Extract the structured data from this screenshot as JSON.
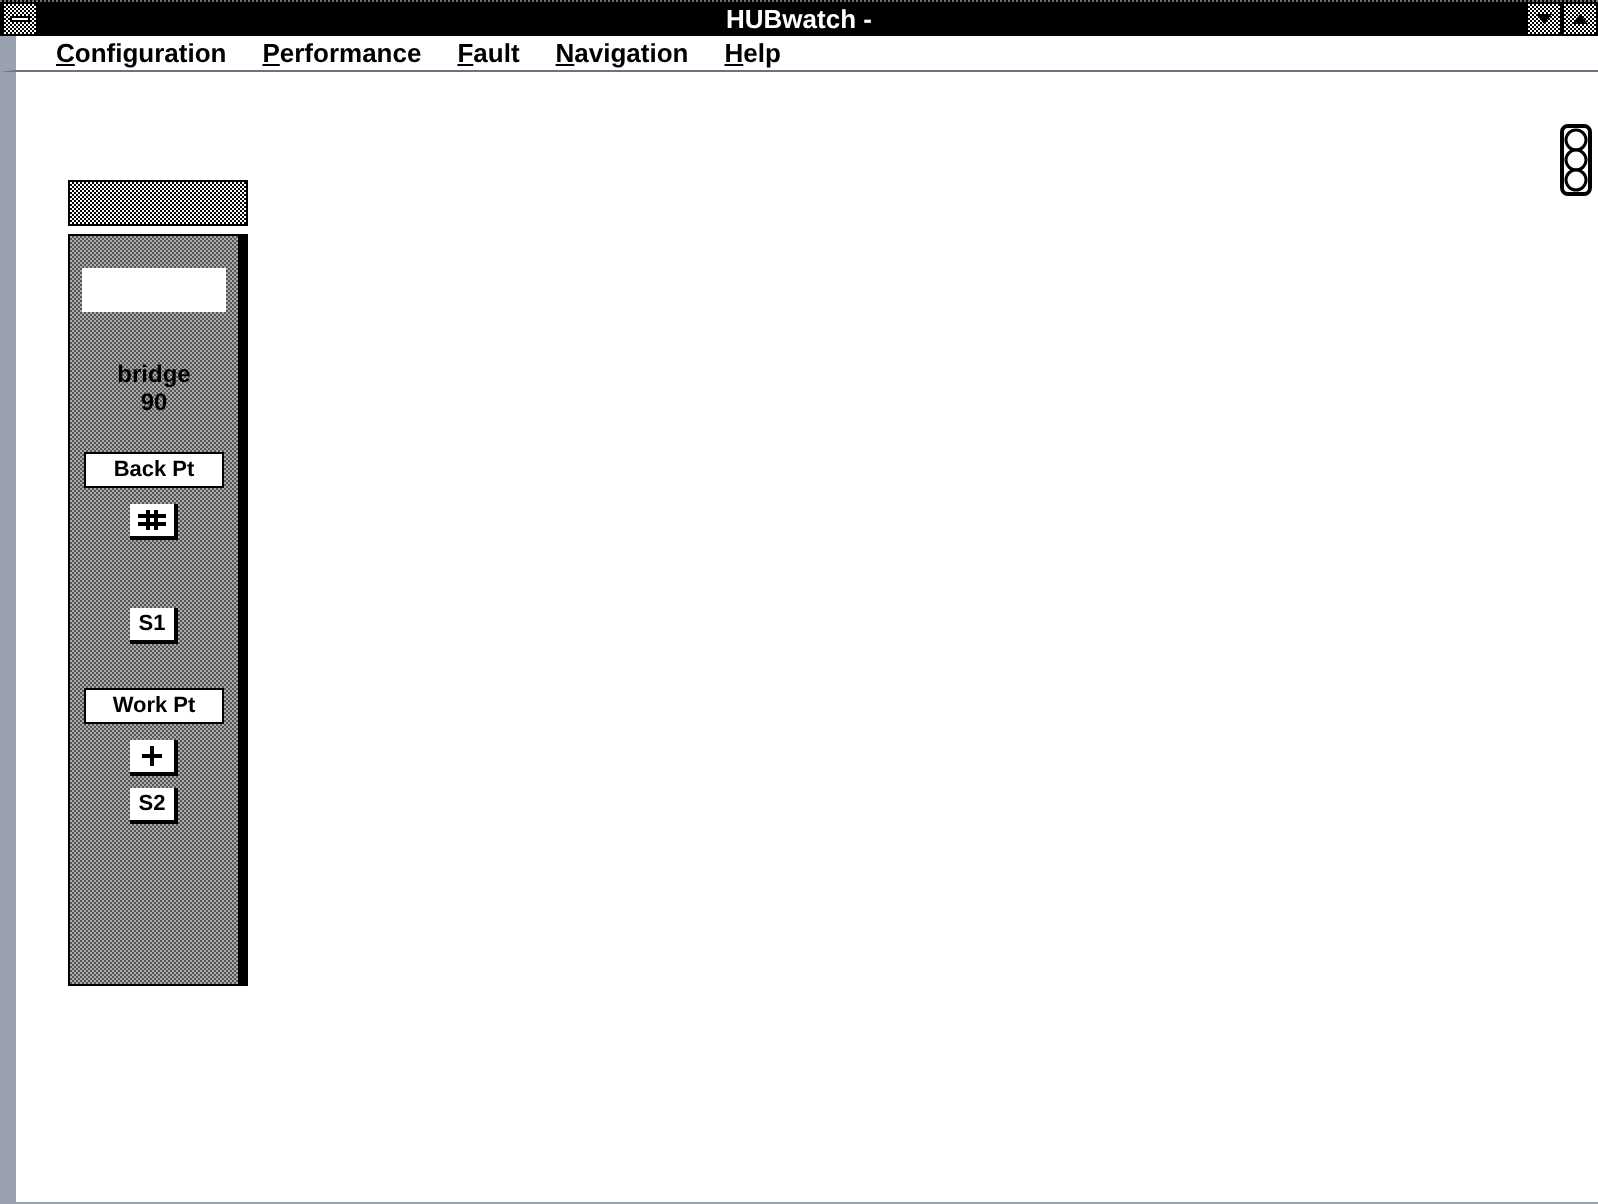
{
  "window": {
    "title": "HUBwatch -"
  },
  "menu": [
    {
      "mnemonic": "C",
      "rest": "onfiguration"
    },
    {
      "mnemonic": "P",
      "rest": "erformance"
    },
    {
      "mnemonic": "F",
      "rest": "ault"
    },
    {
      "mnemonic": "N",
      "rest": "avigation"
    },
    {
      "mnemonic": "H",
      "rest": "elp"
    }
  ],
  "panel": {
    "device": "bridge\n90",
    "items": [
      {
        "kind": "label",
        "text": "Back Pt"
      },
      {
        "kind": "icon"
      },
      {
        "kind": "port",
        "text": "S1"
      },
      {
        "kind": "label",
        "text": "Work Pt"
      },
      {
        "kind": "plus"
      },
      {
        "kind": "port",
        "text": "S2"
      }
    ]
  }
}
